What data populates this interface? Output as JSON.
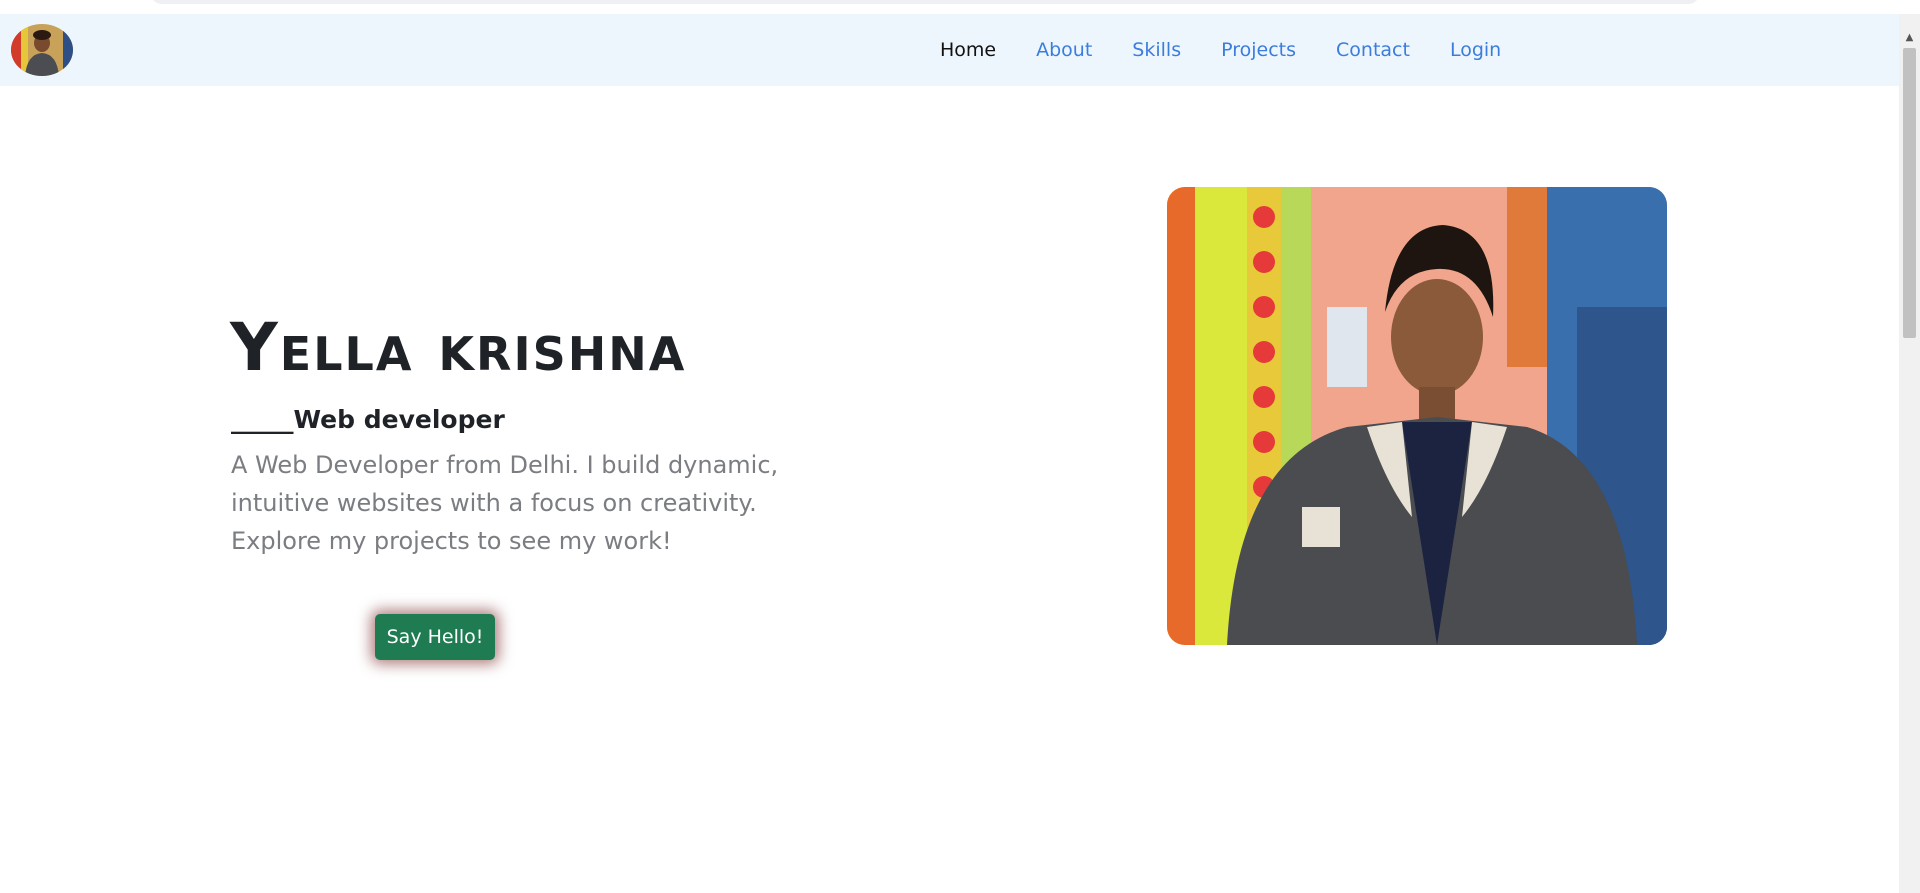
{
  "nav": {
    "items": [
      {
        "label": "Home",
        "active": true
      },
      {
        "label": "About",
        "active": false
      },
      {
        "label": "Skills",
        "active": false
      },
      {
        "label": "Projects",
        "active": false
      },
      {
        "label": "Contact",
        "active": false
      },
      {
        "label": "Login",
        "active": false
      }
    ]
  },
  "hero": {
    "name": "Yella krishna",
    "subtitle": "_____Web developer",
    "intro_lines": [
      "A Web Developer from Delhi. I build dynamic,",
      "intuitive websites with a focus on creativity.",
      "Explore my projects to see my work!"
    ],
    "button_label": "Say Hello!"
  },
  "colors": {
    "nav_background": "#eef6fd",
    "link": "#3b7ddd",
    "active_link": "#111111",
    "button": "#1f7c52",
    "button_glow": "#6e1414",
    "muted_text": "#7a7d81"
  },
  "icons": {
    "logo": "profile-avatar",
    "scroll_up": "scroll-up-arrow-icon"
  }
}
